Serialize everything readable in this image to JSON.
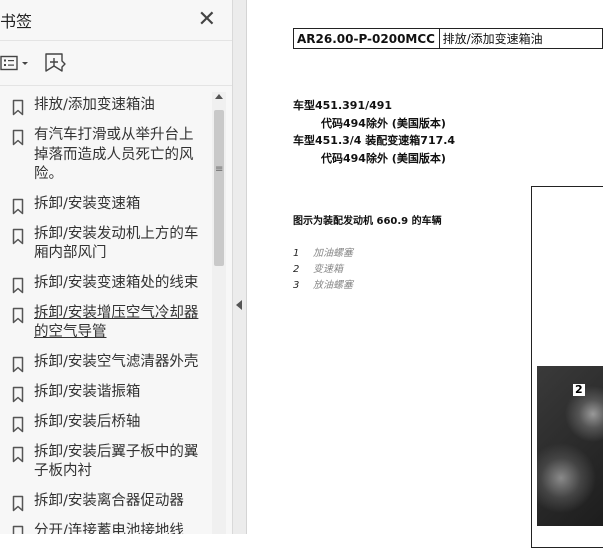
{
  "sidebar": {
    "title": "书签",
    "items": [
      {
        "label": "排放/添加变速箱油",
        "underline": false
      },
      {
        "label": "有汽车打滑或从举升台上掉落而造成人员死亡的风险。",
        "underline": false
      },
      {
        "label": "拆卸/安装变速箱",
        "underline": false
      },
      {
        "label": "拆卸/安装发动机上方的车厢内部风门",
        "underline": false
      },
      {
        "label": "拆卸/安装变速箱处的线束",
        "underline": false
      },
      {
        "label": "拆卸/安装增压空气冷却器的空气导管",
        "underline": true
      },
      {
        "label": "拆卸/安装空气滤清器外壳",
        "underline": false
      },
      {
        "label": "拆卸/安装谐振箱",
        "underline": false
      },
      {
        "label": "拆卸/安装后桥轴",
        "underline": false
      },
      {
        "label": "拆卸/安装后翼子板中的翼子板内衬",
        "underline": false
      },
      {
        "label": "拆卸/安装离合器促动器",
        "underline": false
      },
      {
        "label": "分开/连接蓄电池接地线",
        "underline": false
      }
    ]
  },
  "document": {
    "code": "AR26.00-P-0200MCC",
    "code_title": "排放/添加变速箱油",
    "model_lines": [
      "车型451.391/491",
      "代码494除外 (美国版本)",
      "车型451.3/4 装配变速箱717.4",
      "代码494除外 (美国版本)"
    ],
    "caption": "图示为装配发动机 660.9 的车辆",
    "legend": [
      {
        "num": "1",
        "text": "加油螺塞"
      },
      {
        "num": "2",
        "text": "变速箱"
      },
      {
        "num": "3",
        "text": "放油螺塞"
      }
    ],
    "photo_label": "2"
  }
}
